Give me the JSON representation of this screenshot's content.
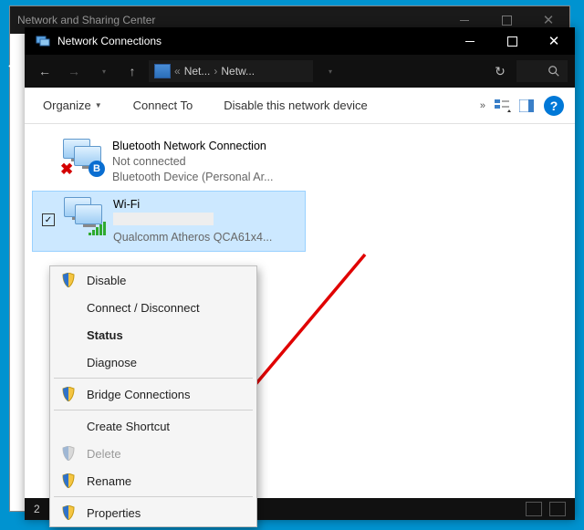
{
  "bgWindow": {
    "title": "Network and Sharing Center"
  },
  "window": {
    "title": "Network Connections"
  },
  "breadcrumb": {
    "seg1": "Net...",
    "seg2": "Netw..."
  },
  "toolbar": {
    "organize": "Organize",
    "connect_to": "Connect To",
    "disable": "Disable this network device",
    "overflow": "»",
    "help": "?"
  },
  "connections": [
    {
      "name": "Bluetooth Network Connection",
      "status": "Not connected",
      "device": "Bluetooth Device (Personal Ar..."
    },
    {
      "name": "Wi-Fi",
      "status": "",
      "device": "Qualcomm Atheros QCA61x4..."
    }
  ],
  "statusbar": {
    "count": "2"
  },
  "ctx": {
    "disable": "Disable",
    "connect": "Connect / Disconnect",
    "status": "Status",
    "diagnose": "Diagnose",
    "bridge": "Bridge Connections",
    "shortcut": "Create Shortcut",
    "delete": "Delete",
    "rename": "Rename",
    "properties": "Properties"
  },
  "checkmark": "✓"
}
